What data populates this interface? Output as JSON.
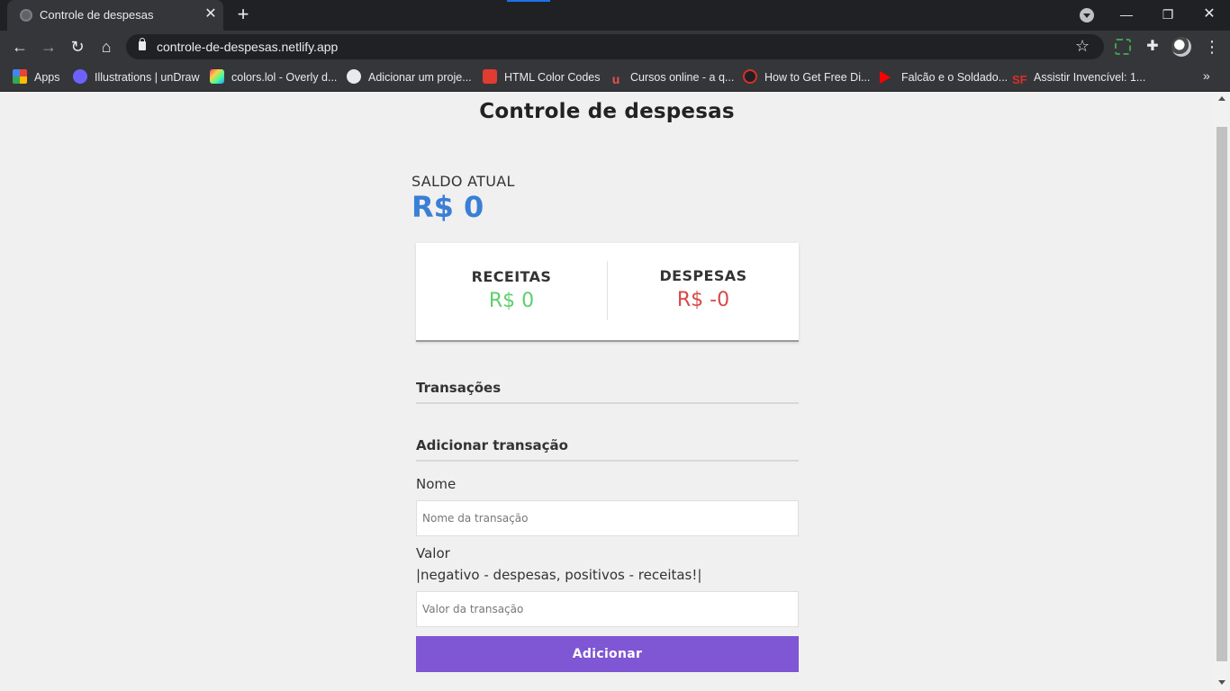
{
  "browser": {
    "tab_title": "Controle de despesas",
    "tab_close": "✕",
    "new_tab": "+",
    "window_min": "—",
    "window_max": "❐",
    "window_close": "✕",
    "url": "controle-de-despesas.netlify.app",
    "bookmarks": [
      {
        "label": "Apps",
        "icon": "apps-grid-icon"
      },
      {
        "label": "Illustrations | unDraw",
        "icon": "undraw-icon"
      },
      {
        "label": "colors.lol - Overly d...",
        "icon": "colors-lol-icon"
      },
      {
        "label": "Adicionar um proje...",
        "icon": "github-icon"
      },
      {
        "label": "HTML Color Codes",
        "icon": "html-color-codes-icon"
      },
      {
        "label": "Cursos online - a q...",
        "icon": "udemy-icon"
      },
      {
        "label": "How to Get Free Di...",
        "icon": "c-logo-icon"
      },
      {
        "label": "Falcão e o Soldado...",
        "icon": "play-icon"
      },
      {
        "label": "Assistir Invencível: 1...",
        "icon": "sf-logo-icon"
      }
    ],
    "bookmarks_overflow": "»"
  },
  "page": {
    "title": "Controle de despesas",
    "balance": {
      "label": "SALDO ATUAL",
      "value": "R$ 0"
    },
    "income": {
      "label": "RECEITAS",
      "value": "R$ 0",
      "color": "#5ecf6c"
    },
    "expense": {
      "label": "DESPESAS",
      "value": "R$ -0",
      "color": "#d94848"
    },
    "transactions_heading": "Transações",
    "add_heading": "Adicionar transação",
    "form": {
      "name_label": "Nome",
      "name_placeholder": "Nome da transação",
      "value_label": "Valor",
      "value_hint": "|negativo - despesas, positivos - receitas!|",
      "value_placeholder": "Valor da transação",
      "submit_label": "Adicionar",
      "submit_color": "#7f56d4"
    }
  }
}
